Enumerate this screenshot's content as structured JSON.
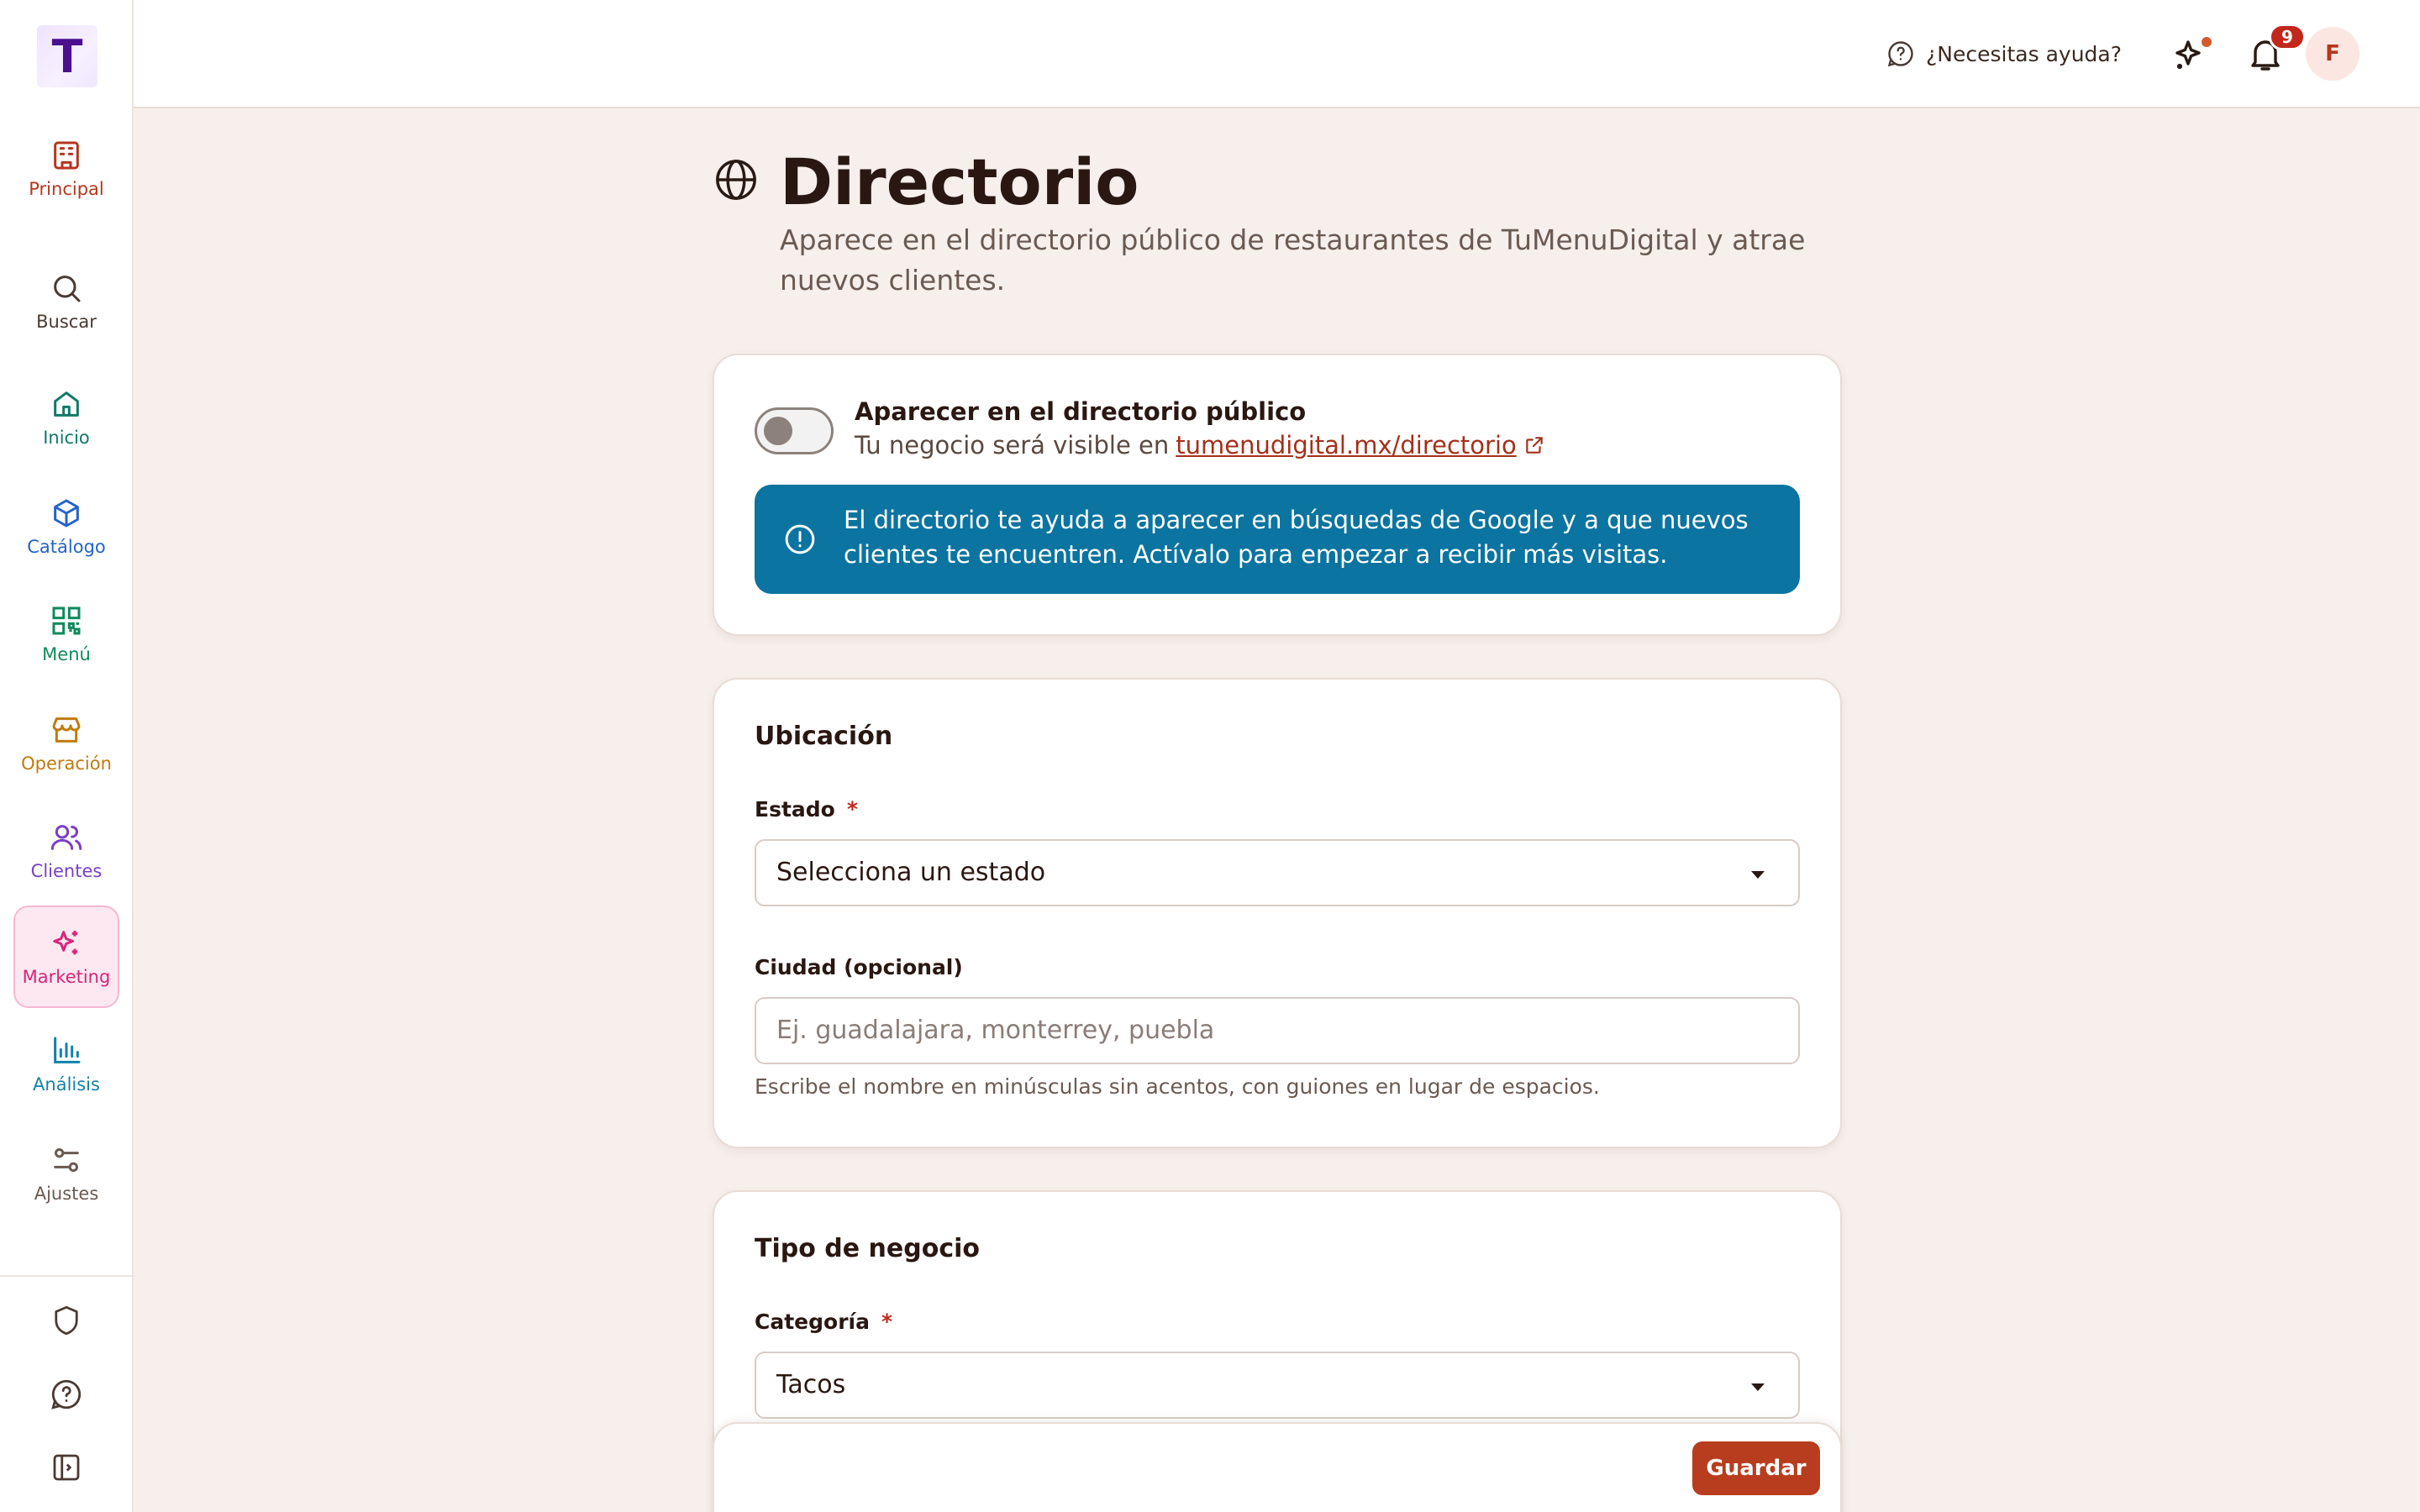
{
  "app": {
    "logo_letter": "T"
  },
  "sidebar": {
    "items": [
      {
        "label": "Principal",
        "color": "#b5361f"
      },
      {
        "label": "Buscar",
        "color": "#4a3a33"
      },
      {
        "label": "Inicio",
        "color": "#0f7a6a"
      },
      {
        "label": "Catálogo",
        "color": "#2463c9"
      },
      {
        "label": "Menú",
        "color": "#0f8a5a"
      },
      {
        "label": "Operación",
        "color": "#c27a0e"
      },
      {
        "label": "Clientes",
        "color": "#7a3fc7"
      },
      {
        "label": "Marketing",
        "color": "#d6267a",
        "active": true
      },
      {
        "label": "Análisis",
        "color": "#1282a8"
      },
      {
        "label": "Ajustes",
        "color": "#6b5a52"
      }
    ]
  },
  "topbar": {
    "help_label": "¿Necesitas ayuda?",
    "notifications_count": "9",
    "avatar_initial": "F"
  },
  "page": {
    "title": "Directorio",
    "subtitle": "Aparece en el directorio público de restaurantes de TuMenuDigital y atrae nuevos clientes."
  },
  "visibility": {
    "toggle_on": false,
    "title": "Aparecer en el directorio público",
    "sub_prefix": "Tu negocio será visible en",
    "link": "tumenudigital.mx/directorio",
    "info": "El directorio te ayuda a aparecer en búsquedas de Google y a que nuevos clientes te encuentren. Actívalo para empezar a recibir más visitas."
  },
  "location": {
    "title": "Ubicación",
    "state_label": "Estado",
    "required_mark": "*",
    "state_value": "Selecciona un estado",
    "city_label": "Ciudad (opcional)",
    "city_placeholder": "Ej. guadalajara, monterrey, puebla",
    "city_hint": "Escribe el nombre en minúsculas sin acentos, con guiones en lugar de espacios."
  },
  "business": {
    "title": "Tipo de negocio",
    "category_label": "Categoría",
    "required_mark": "*",
    "category_value": "Tacos"
  },
  "actions": {
    "save_label": "Guardar"
  }
}
